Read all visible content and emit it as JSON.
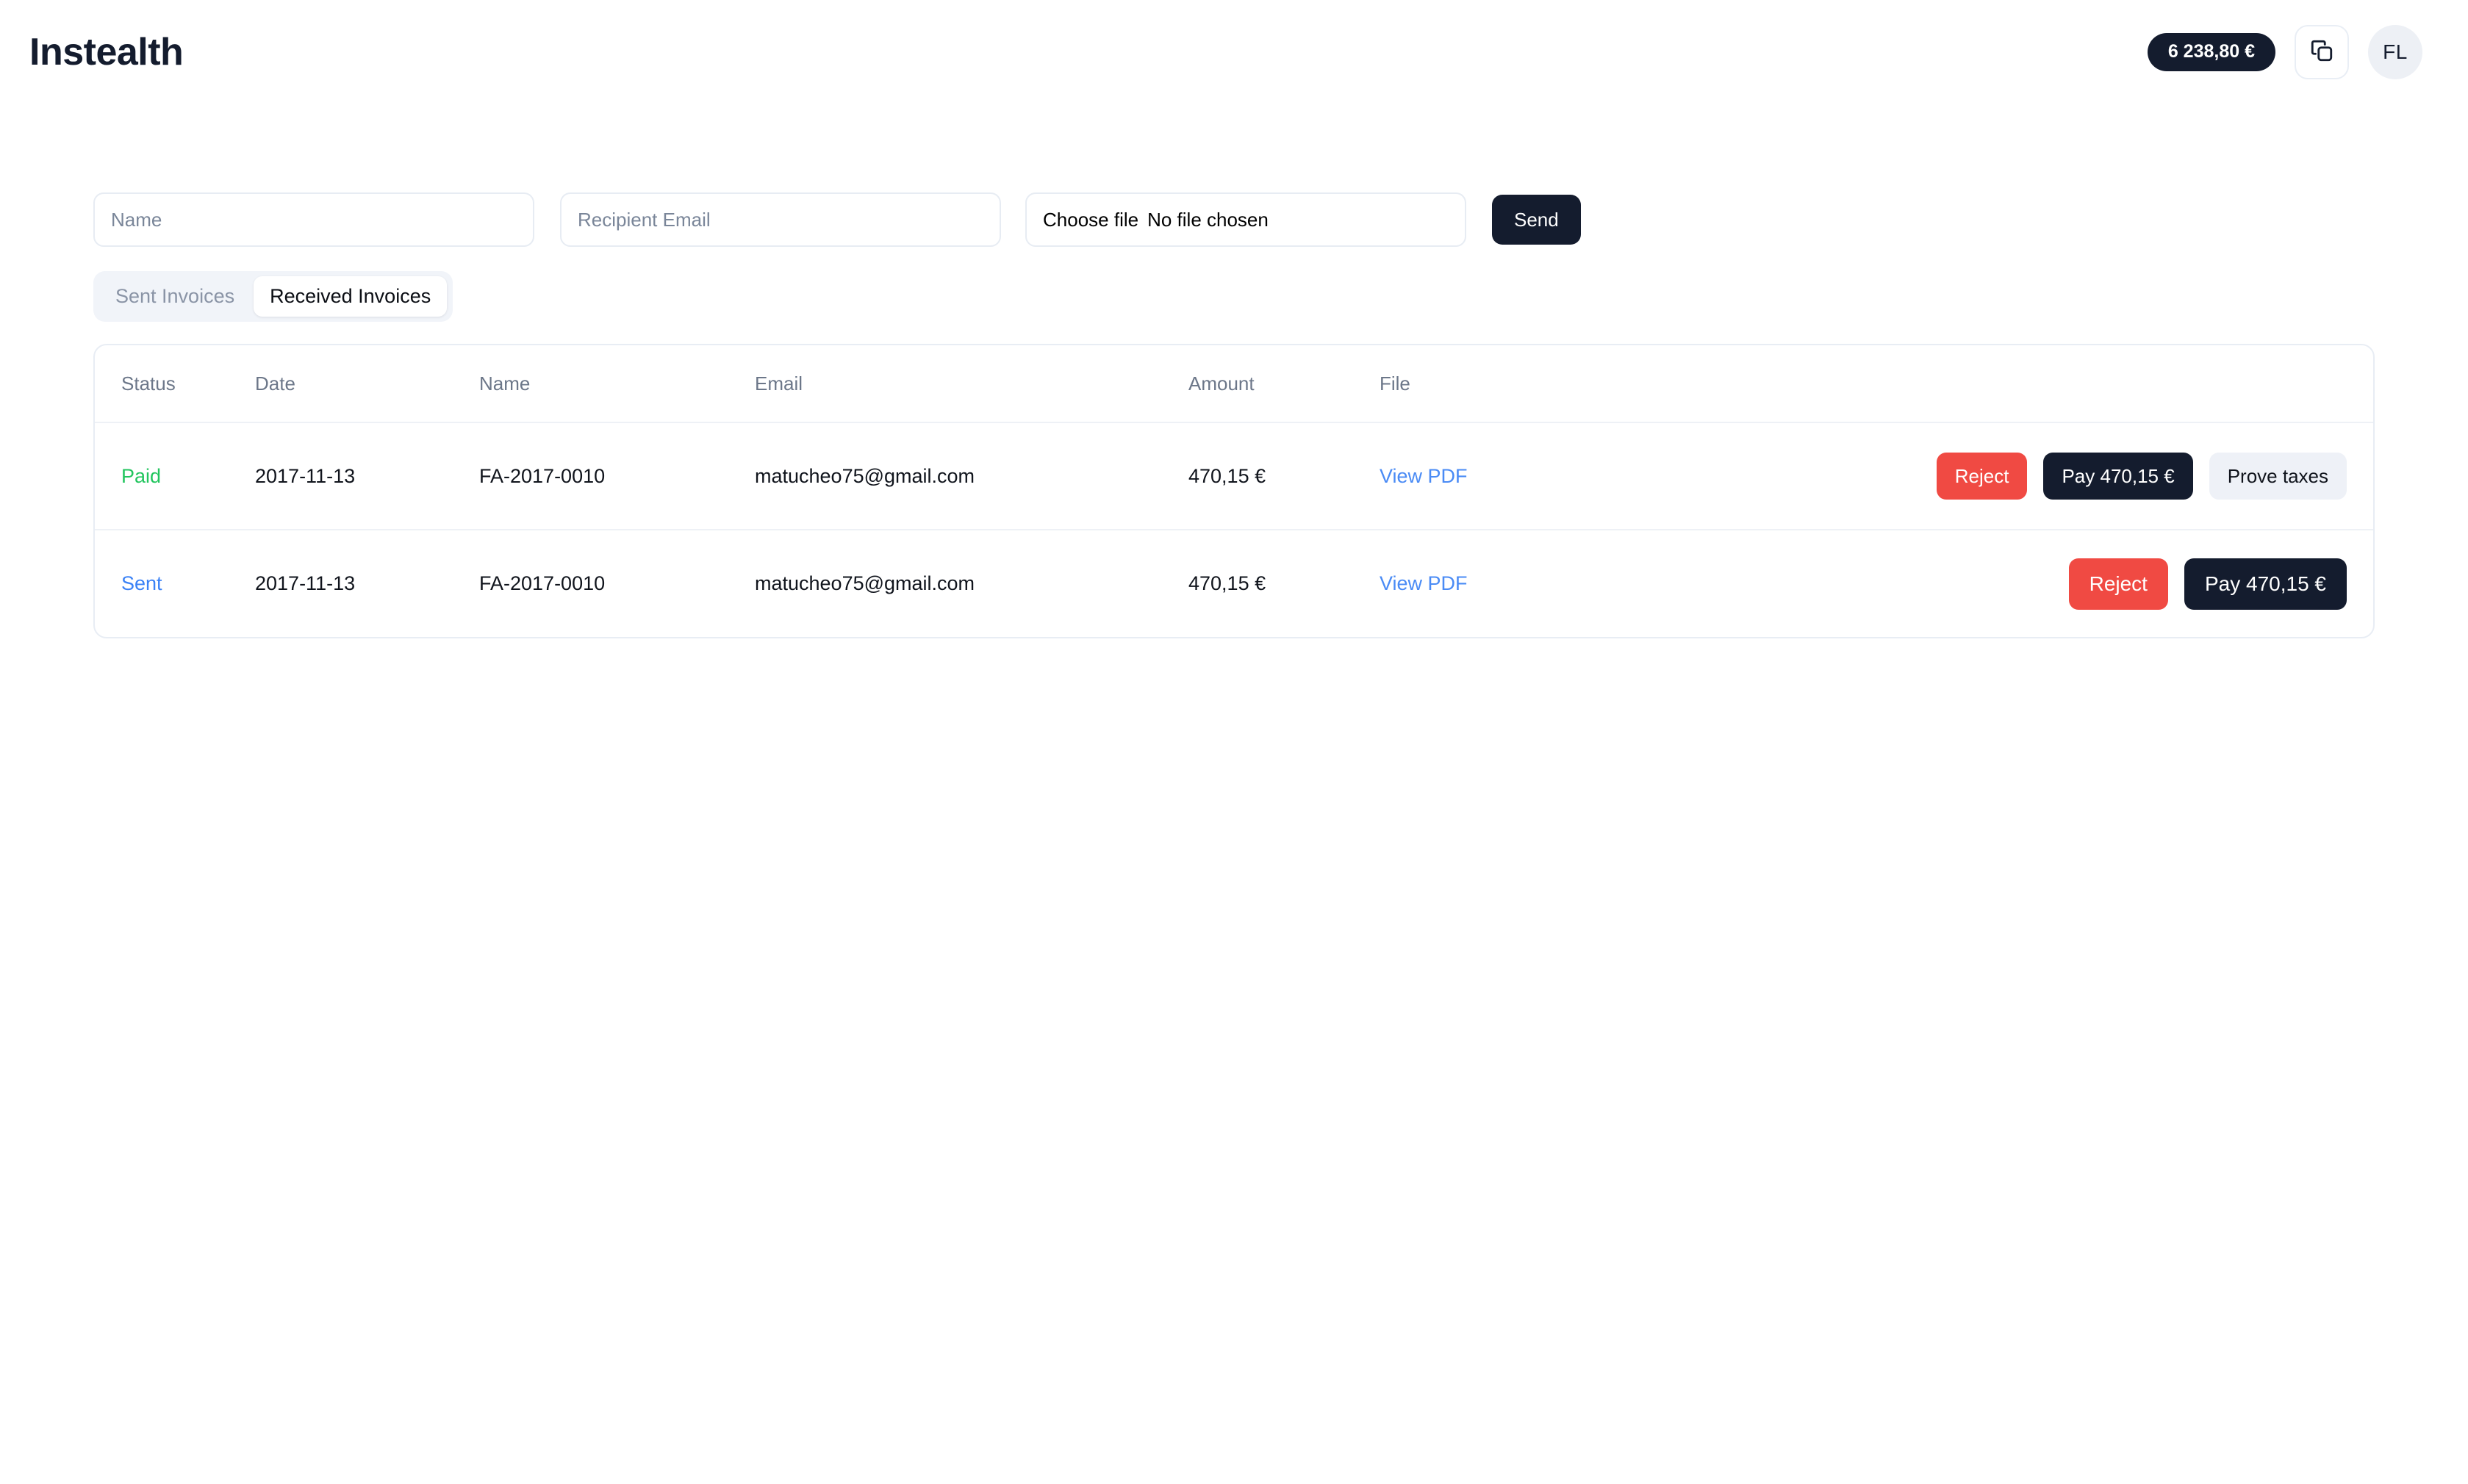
{
  "app": {
    "brand": "Instealth"
  },
  "header": {
    "balance": "6 238,80 €",
    "copy_icon": "copy-icon",
    "avatar_initials": "FL"
  },
  "form": {
    "name_placeholder": "Name",
    "name_value": "",
    "email_placeholder": "Recipient Email",
    "email_value": "",
    "file_button_label": "Choose file",
    "file_status": "No file chosen",
    "send_label": "Send"
  },
  "tabs": [
    {
      "label": "Sent Invoices",
      "active": false
    },
    {
      "label": "Received Invoices",
      "active": true
    }
  ],
  "table": {
    "columns": [
      "Status",
      "Date",
      "Name",
      "Email",
      "Amount",
      "File",
      ""
    ],
    "rows": [
      {
        "status": "Paid",
        "status_color": "#22c55e",
        "date": "2017-11-13",
        "name": "FA-2017-0010",
        "email": "matucheo75@gmail.com",
        "amount": "470,15 €",
        "file_link": "View PDF",
        "actions": [
          {
            "label": "Reject",
            "style": "reject"
          },
          {
            "label": "Pay 470,15 €",
            "style": "pay"
          },
          {
            "label": "Prove taxes",
            "style": "prove"
          }
        ]
      },
      {
        "status": "Sent",
        "status_color": "#3b82f6",
        "date": "2017-11-13",
        "name": "FA-2017-0010",
        "email": "matucheo75@gmail.com",
        "amount": "470,15 €",
        "file_link": "View PDF",
        "actions": [
          {
            "label": "Reject",
            "style": "reject"
          },
          {
            "label": "Pay 470,15 €",
            "style": "pay"
          }
        ]
      }
    ]
  },
  "colors": {
    "dark": "#141c2e",
    "danger": "#f04a43",
    "link": "#4a8bf5",
    "paid": "#22c55e",
    "sent": "#3b82f6",
    "muted": "#6c7789",
    "border": "#e8edf4"
  }
}
